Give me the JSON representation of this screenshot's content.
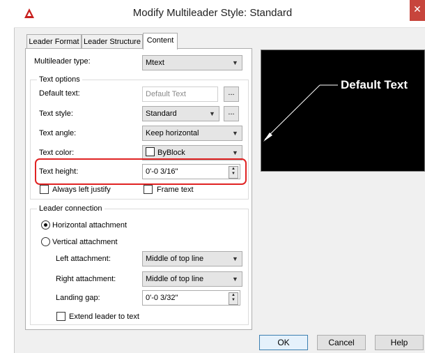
{
  "window": {
    "title": "Modify Multileader Style: Standard",
    "close_glyph": "✕"
  },
  "tabs": [
    {
      "label": "Leader Format"
    },
    {
      "label": "Leader Structure"
    },
    {
      "label": "Content"
    }
  ],
  "content": {
    "multileader_type": {
      "label": "Multileader type:",
      "value": "Mtext"
    },
    "text_options": {
      "legend": "Text options",
      "default_text": {
        "label": "Default text:",
        "value": "Default Text",
        "button": "..."
      },
      "text_style": {
        "label": "Text style:",
        "value": "Standard",
        "button": "..."
      },
      "text_angle": {
        "label": "Text angle:",
        "value": "Keep horizontal"
      },
      "text_color": {
        "label": "Text color:",
        "value": "ByBlock"
      },
      "text_height": {
        "label": "Text height:",
        "value": "0'-0 3/16\""
      },
      "always_left_justify": {
        "label": "Always left justify",
        "checked": false
      },
      "frame_text": {
        "label": "Frame text",
        "checked": false
      }
    },
    "leader_connection": {
      "legend": "Leader connection",
      "horizontal": {
        "label": "Horizontal attachment",
        "selected": true
      },
      "vertical": {
        "label": "Vertical attachment",
        "selected": false
      },
      "left_attachment": {
        "label": "Left attachment:",
        "value": "Middle of top line"
      },
      "right_attachment": {
        "label": "Right attachment:",
        "value": "Middle of top line"
      },
      "landing_gap": {
        "label": "Landing gap:",
        "value": "0'-0 3/32\""
      },
      "extend_leader": {
        "label": "Extend leader to text",
        "checked": false
      }
    }
  },
  "preview": {
    "text": "Default Text"
  },
  "buttons": {
    "ok": "OK",
    "cancel": "Cancel",
    "help": "Help"
  },
  "colors": {
    "highlight": "#e02323",
    "preview_bg": "#000000",
    "title_icon": "#c8201e"
  }
}
